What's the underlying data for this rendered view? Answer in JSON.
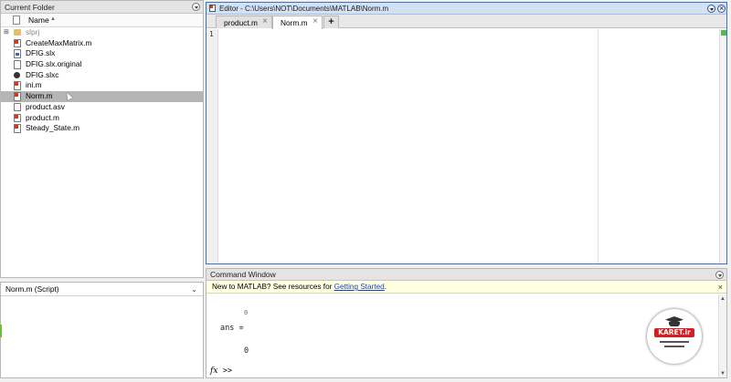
{
  "current_folder": {
    "title": "Current Folder",
    "column_header": "Name",
    "sort_indicator": "▲",
    "files": [
      {
        "name": "slprj",
        "type": "folder",
        "expander": "⊞",
        "faded": true
      },
      {
        "name": "CreateMaxMatrix.m",
        "type": "m"
      },
      {
        "name": "DFIG.slx",
        "type": "slx"
      },
      {
        "name": "DFIG.slx.original",
        "type": "doc"
      },
      {
        "name": "DFIG.slxc",
        "type": "slxc"
      },
      {
        "name": "ini.m",
        "type": "m"
      },
      {
        "name": "Norm.m",
        "type": "m",
        "selected": true
      },
      {
        "name": "product.asv",
        "type": "doc"
      },
      {
        "name": "product.m",
        "type": "m"
      },
      {
        "name": "Steady_State.m",
        "type": "m"
      }
    ]
  },
  "details": {
    "label": "Norm.m  (Script)",
    "chevron": "⌄"
  },
  "editor": {
    "title": "Editor - C:\\Users\\NOT\\Documents\\MATLAB\\Norm.m",
    "tabs": [
      {
        "label": "product.m",
        "close": "×",
        "active": false
      },
      {
        "label": "Norm.m",
        "close": "×",
        "active": true
      }
    ],
    "add_tab": "+",
    "line_numbers": [
      "1"
    ]
  },
  "command_window": {
    "title": "Command Window",
    "notice_prefix": "New to MATLAB? See resources for ",
    "notice_link": "Getting Started",
    "notice_suffix": ".",
    "notice_close": "×",
    "partial_value": "0",
    "ans_label": "ans =",
    "ans_value": "0",
    "fx": "fx",
    "prompt": ">>"
  },
  "watermark": {
    "brand": "KARET.ir"
  },
  "colors": {
    "editor_border": "#3a72c6",
    "selected_row": "#b5b5b5",
    "notice_bg": "#ffffe1",
    "link": "#1a3fd0",
    "watermark_red": "#d51f1f"
  }
}
